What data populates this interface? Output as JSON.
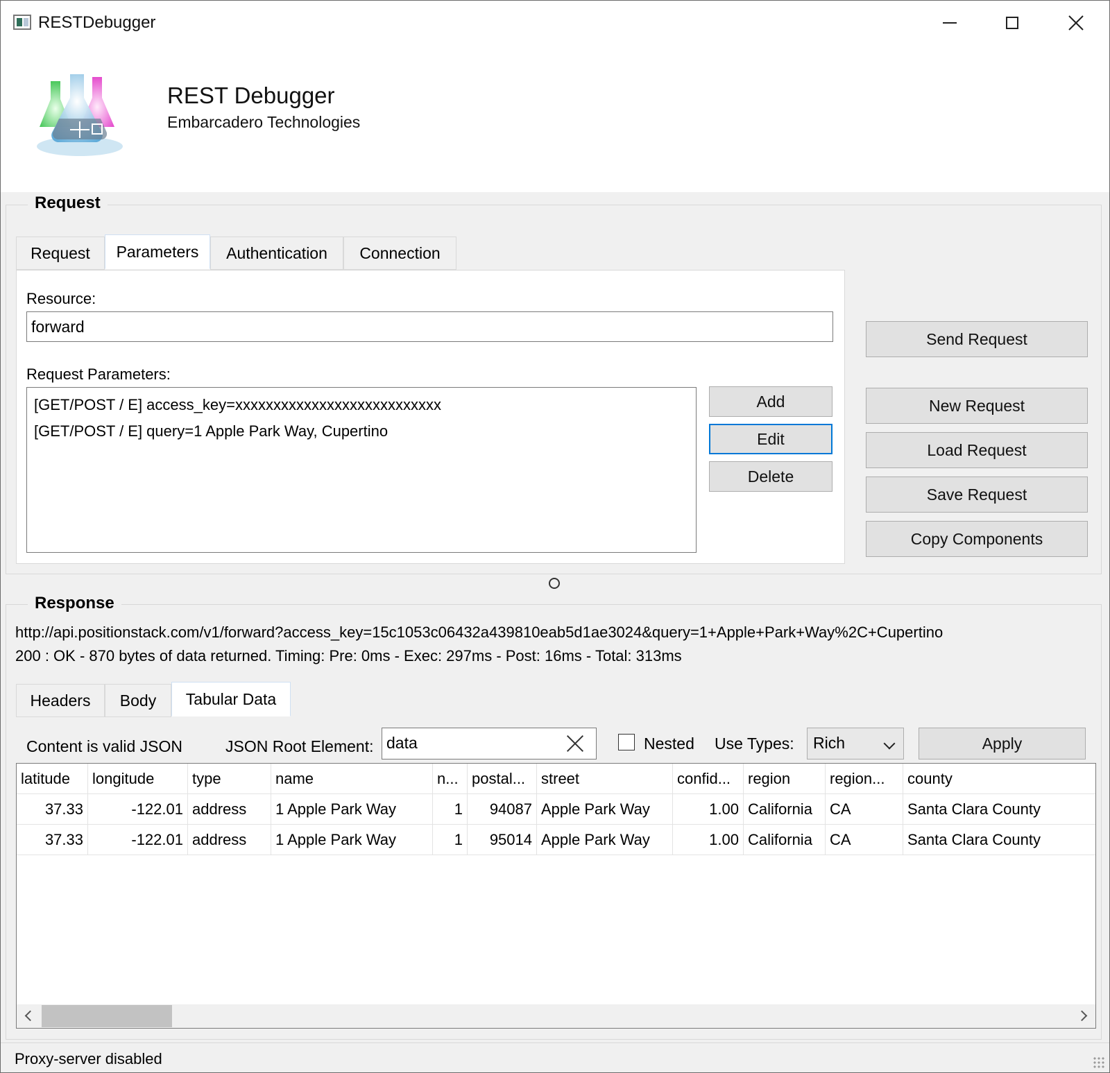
{
  "window": {
    "title": "RESTDebugger"
  },
  "header": {
    "title": "REST Debugger",
    "subtitle": "Embarcadero Technologies"
  },
  "request_group": {
    "legend": "Request",
    "tabs": [
      "Request",
      "Parameters",
      "Authentication",
      "Connection"
    ],
    "active_tab": "Parameters",
    "resource_label": "Resource:",
    "resource_value": "forward",
    "params_label": "Request Parameters:",
    "params": [
      "[GET/POST / E] access_key=xxxxxxxxxxxxxxxxxxxxxxxxxxx",
      "[GET/POST / E] query=1 Apple Park Way, Cupertino"
    ],
    "param_buttons": {
      "add": "Add",
      "edit": "Edit",
      "delete": "Delete"
    },
    "actions": {
      "send": "Send Request",
      "new": "New Request",
      "load": "Load Request",
      "save": "Save Request",
      "copy": "Copy Components"
    }
  },
  "response_group": {
    "legend": "Response",
    "url": "http://api.positionstack.com/v1/forward?access_key=15c1053c06432a439810eab5d1ae3024&query=1+Apple+Park+Way%2C+Cupertino",
    "status": "200 : OK - 870 bytes of data returned. Timing: Pre: 0ms - Exec: 297ms - Post: 16ms - Total: 313ms",
    "tabs": [
      "Headers",
      "Body",
      "Tabular Data"
    ],
    "active_tab": "Tabular Data",
    "valid_json": "Content is valid JSON",
    "root_label": "JSON Root Element:",
    "root_value": "data",
    "nested_label": "Nested",
    "nested_checked": false,
    "use_types_label": "Use Types:",
    "use_types_value": "Rich",
    "apply_label": "Apply",
    "grid": {
      "columns": [
        "latitude",
        "longitude",
        "type",
        "name",
        "n...",
        "postal...",
        "street",
        "confid...",
        "region",
        "region...",
        "county"
      ],
      "rows": [
        [
          "37.33",
          "-122.01",
          "address",
          "1 Apple Park Way",
          "1",
          "94087",
          "Apple Park Way",
          "1.00",
          "California",
          "CA",
          "Santa Clara County"
        ],
        [
          "37.33",
          "-122.01",
          "address",
          "1 Apple Park Way",
          "1",
          "95014",
          "Apple Park Way",
          "1.00",
          "California",
          "CA",
          "Santa Clara County"
        ]
      ]
    }
  },
  "statusbar": {
    "text": "Proxy-server disabled"
  }
}
